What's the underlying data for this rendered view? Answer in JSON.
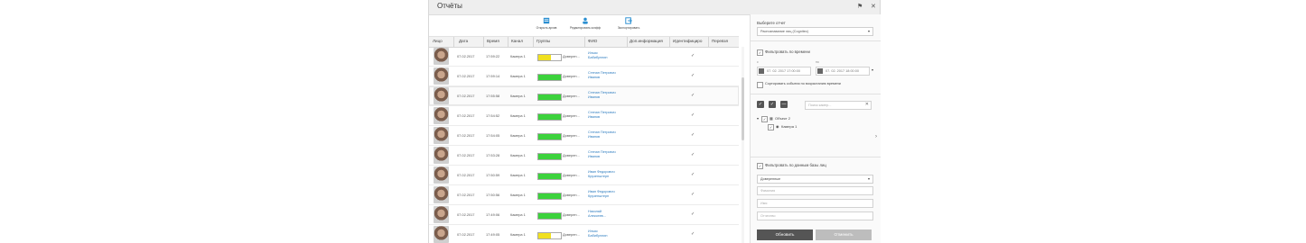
{
  "window": {
    "title": "Отчёты"
  },
  "toolbar": {
    "open": "Открыть архив",
    "edit_face": "Редактировать коэфф",
    "export": "Экспортировать"
  },
  "columns": [
    "Лицо",
    "Дата",
    "Время",
    "Канал",
    "Группы",
    "ФИО",
    "Доп.информация",
    "Идентифициро",
    "Перевзя"
  ],
  "rows": [
    {
      "date": "07.02.2017",
      "time": "17:59:22",
      "channel": "Камера 1",
      "group": "Доверен...",
      "name1": "Ильяс",
      "name2": "Бабибуллин",
      "ident": "✓",
      "bar_color": "#f0e020",
      "bar_level": 0.55
    },
    {
      "date": "07.02.2017",
      "time": "17:59:14",
      "channel": "Камера 1",
      "group": "Доверен...",
      "name1": "Степан Петрович",
      "name2": "Иванов",
      "ident": "✓",
      "bar_color": "#3cd23c",
      "bar_level": 1.0
    },
    {
      "date": "07.02.2017",
      "time": "17:55:58",
      "channel": "Камера 1",
      "group": "Доверен...",
      "name1": "Степан Петрович",
      "name2": "Иванов",
      "ident": "✓",
      "bar_color": "#3cd23c",
      "bar_level": 1.0
    },
    {
      "date": "07.02.2017",
      "time": "17:54:52",
      "channel": "Камера 1",
      "group": "Доверен...",
      "name1": "Степан Петрович",
      "name2": "Иванов",
      "ident": "✓",
      "bar_color": "#3cd23c",
      "bar_level": 1.0
    },
    {
      "date": "07.02.2017",
      "time": "17:54:05",
      "channel": "Камера 1",
      "group": "Доверен...",
      "name1": "Степан Петрович",
      "name2": "Иванов",
      "ident": "✓",
      "bar_color": "#3cd23c",
      "bar_level": 1.0
    },
    {
      "date": "07.02.2017",
      "time": "17:53:28",
      "channel": "Камера 1",
      "group": "Доверен...",
      "name1": "Степан Петрович",
      "name2": "Иванов",
      "ident": "✓",
      "bar_color": "#3cd23c",
      "bar_level": 1.0
    },
    {
      "date": "07.02.2017",
      "time": "17:50:59",
      "channel": "Камера 1",
      "group": "Доверен...",
      "name1": "Иван Федорович",
      "name2": "Крузенштерн",
      "ident": "✓",
      "bar_color": "#3cd23c",
      "bar_level": 1.0
    },
    {
      "date": "07.02.2017",
      "time": "17:50:56",
      "channel": "Камера 1",
      "group": "Доверен...",
      "name1": "Иван Федорович",
      "name2": "Крузенштерн",
      "ident": "✓",
      "bar_color": "#3cd23c",
      "bar_level": 1.0
    },
    {
      "date": "07.02.2017",
      "time": "17:49:06",
      "channel": "Камера 1",
      "group": "Доверен...",
      "name1": "Николай",
      "name2": "Алексеев...",
      "ident": "✓",
      "bar_color": "#3cd23c",
      "bar_level": 1.0
    },
    {
      "date": "07.02.2017",
      "time": "17:49:05",
      "channel": "Камера 1",
      "group": "Доверен...",
      "name1": "Ильяс",
      "name2": "Бабибуллин",
      "ident": "✓",
      "bar_color": "#f0e020",
      "bar_level": 0.55
    }
  ],
  "panel": {
    "report_label": "Выберите отчет",
    "report_value": "Распознавание лиц (Cognitec)",
    "filter_time_label": "Фильтровать по времени",
    "from_label": "с",
    "to_label": "по",
    "from_value": "07. 02. 2017   17:00:00",
    "to_value": "07. 02. 2017   18:00:00",
    "sort_label": "Сортировать события по возрастанию времени",
    "search_placeholder": "Поиск камер...",
    "tree_object": "Объект 2",
    "tree_camera": "Камера 1",
    "filter_db_label": "Фильтровать по данным базы лиц",
    "db_group_value": "Доверенные",
    "surname_placeholder": "Фамилия",
    "firstname_placeholder": "Имя",
    "patronymic_placeholder": "Отчество",
    "refresh": "Обновить",
    "cancel": "Отменить"
  },
  "colors": {
    "primary_button": "#555555",
    "disabled_button": "#bdbdbd",
    "link": "#2b7bbf"
  }
}
